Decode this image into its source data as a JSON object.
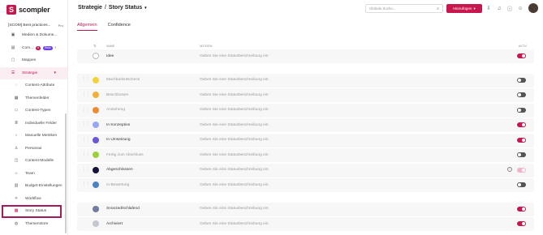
{
  "app": {
    "name": "scompler"
  },
  "workspace": {
    "name": "[SCOM] Best practices...",
    "plan": "Pro"
  },
  "nav": {
    "items": [
      {
        "label": "Medien & Dokume...",
        "icon": "media-icon"
      },
      {
        "label": "Com...",
        "icon": "community-icon",
        "badge1": "6",
        "badge2": "Beta"
      },
      {
        "label": "Mappen",
        "icon": "folder-icon"
      },
      {
        "label": "Strategie",
        "icon": "strategy-icon"
      },
      {
        "label": "Content-Attribute",
        "icon": "attribute-icon"
      },
      {
        "label": "Themenfelder",
        "icon": "topics-icon"
      },
      {
        "label": "Content-Typen",
        "icon": "content-type-icon"
      },
      {
        "label": "Individuelle Felder",
        "icon": "fields-icon"
      },
      {
        "label": "Manuelle Metriken",
        "icon": "metrics-icon"
      },
      {
        "label": "Personas",
        "icon": "personas-icon"
      },
      {
        "label": "Content-Modelle",
        "icon": "model-icon"
      },
      {
        "label": "Team",
        "icon": "team-icon"
      },
      {
        "label": "Budget-Einstellungen",
        "icon": "budget-icon"
      },
      {
        "label": "Workflow",
        "icon": "workflow-icon"
      },
      {
        "label": "Story Status",
        "icon": "story-status-icon"
      },
      {
        "label": "Themenstore",
        "icon": "store-icon"
      }
    ]
  },
  "header": {
    "crumb_parent": "Strategie",
    "crumb_sep": "/",
    "crumb_current": "Story Status",
    "search_placeholder": "Globale Suche...",
    "add_label": "Hinzufügen"
  },
  "tabs": [
    {
      "label": "Allgemein"
    },
    {
      "label": "Confidence"
    }
  ],
  "table": {
    "col_name": "Name",
    "col_notes": "Notizen",
    "col_active": "Aktiv",
    "group1": [
      {
        "name": "Idee",
        "note": "Geben Sie eine Statusbeschreibung ein",
        "color": "#ffffff",
        "active": "on",
        "dimmed": false
      }
    ],
    "group2": [
      {
        "name": "Machbarkeitscheck",
        "note": "Geben Sie eine Statusbeschreibung ein",
        "color": "#f2d13a",
        "active": "off",
        "dimmed": true
      },
      {
        "name": "Beschlossen",
        "note": "Geben Sie eine Statusbeschreibung ein",
        "color": "#f0b03c",
        "active": "off",
        "dimmed": true
      },
      {
        "name": "Ansteheng",
        "note": "Geben Sie eine Statusbeschreibung ein",
        "color": "#ee8a33",
        "active": "off",
        "dimmed": true
      },
      {
        "name": "In Konzeption",
        "note": "Geben Sie eine Statusbeschreibung ein",
        "color": "#9aa6f0",
        "active": "on",
        "dimmed": false
      },
      {
        "name": "In Umsetzung",
        "note": "Geben Sie eine Statusbeschreibung ein",
        "color": "#6b56d9",
        "active": "on",
        "dimmed": false
      },
      {
        "name": "Fertig zum Abschluss",
        "note": "Geben Sie eine Statusbeschreibung ein",
        "color": "#9ccf3a",
        "active": "off",
        "dimmed": true
      },
      {
        "name": "Abgeschlossen",
        "note": "Geben Sie eine Statusbeschreibung ein",
        "color": "#12123a",
        "active": "disabled",
        "dimmed": false,
        "info": "i"
      },
      {
        "name": "In Bewertung",
        "note": "Geben Sie eine Statusbeschreibung ein",
        "color": "#4b82c0",
        "active": "off",
        "dimmed": true
      }
    ],
    "group3": [
      {
        "name": "Snoozed/schlafend",
        "note": "Geben Sie eine Statusbeschreibung ein",
        "color": "#6f7ca0",
        "active": "on",
        "dimmed": false
      },
      {
        "name": "Archiviert",
        "note": "Geben Sie eine Statusbeschreibung ein",
        "color": "#c4c7cc",
        "active": "on",
        "dimmed": false
      }
    ]
  },
  "colors": {
    "brand": "#c8174c",
    "highlight": "#a6195b"
  }
}
